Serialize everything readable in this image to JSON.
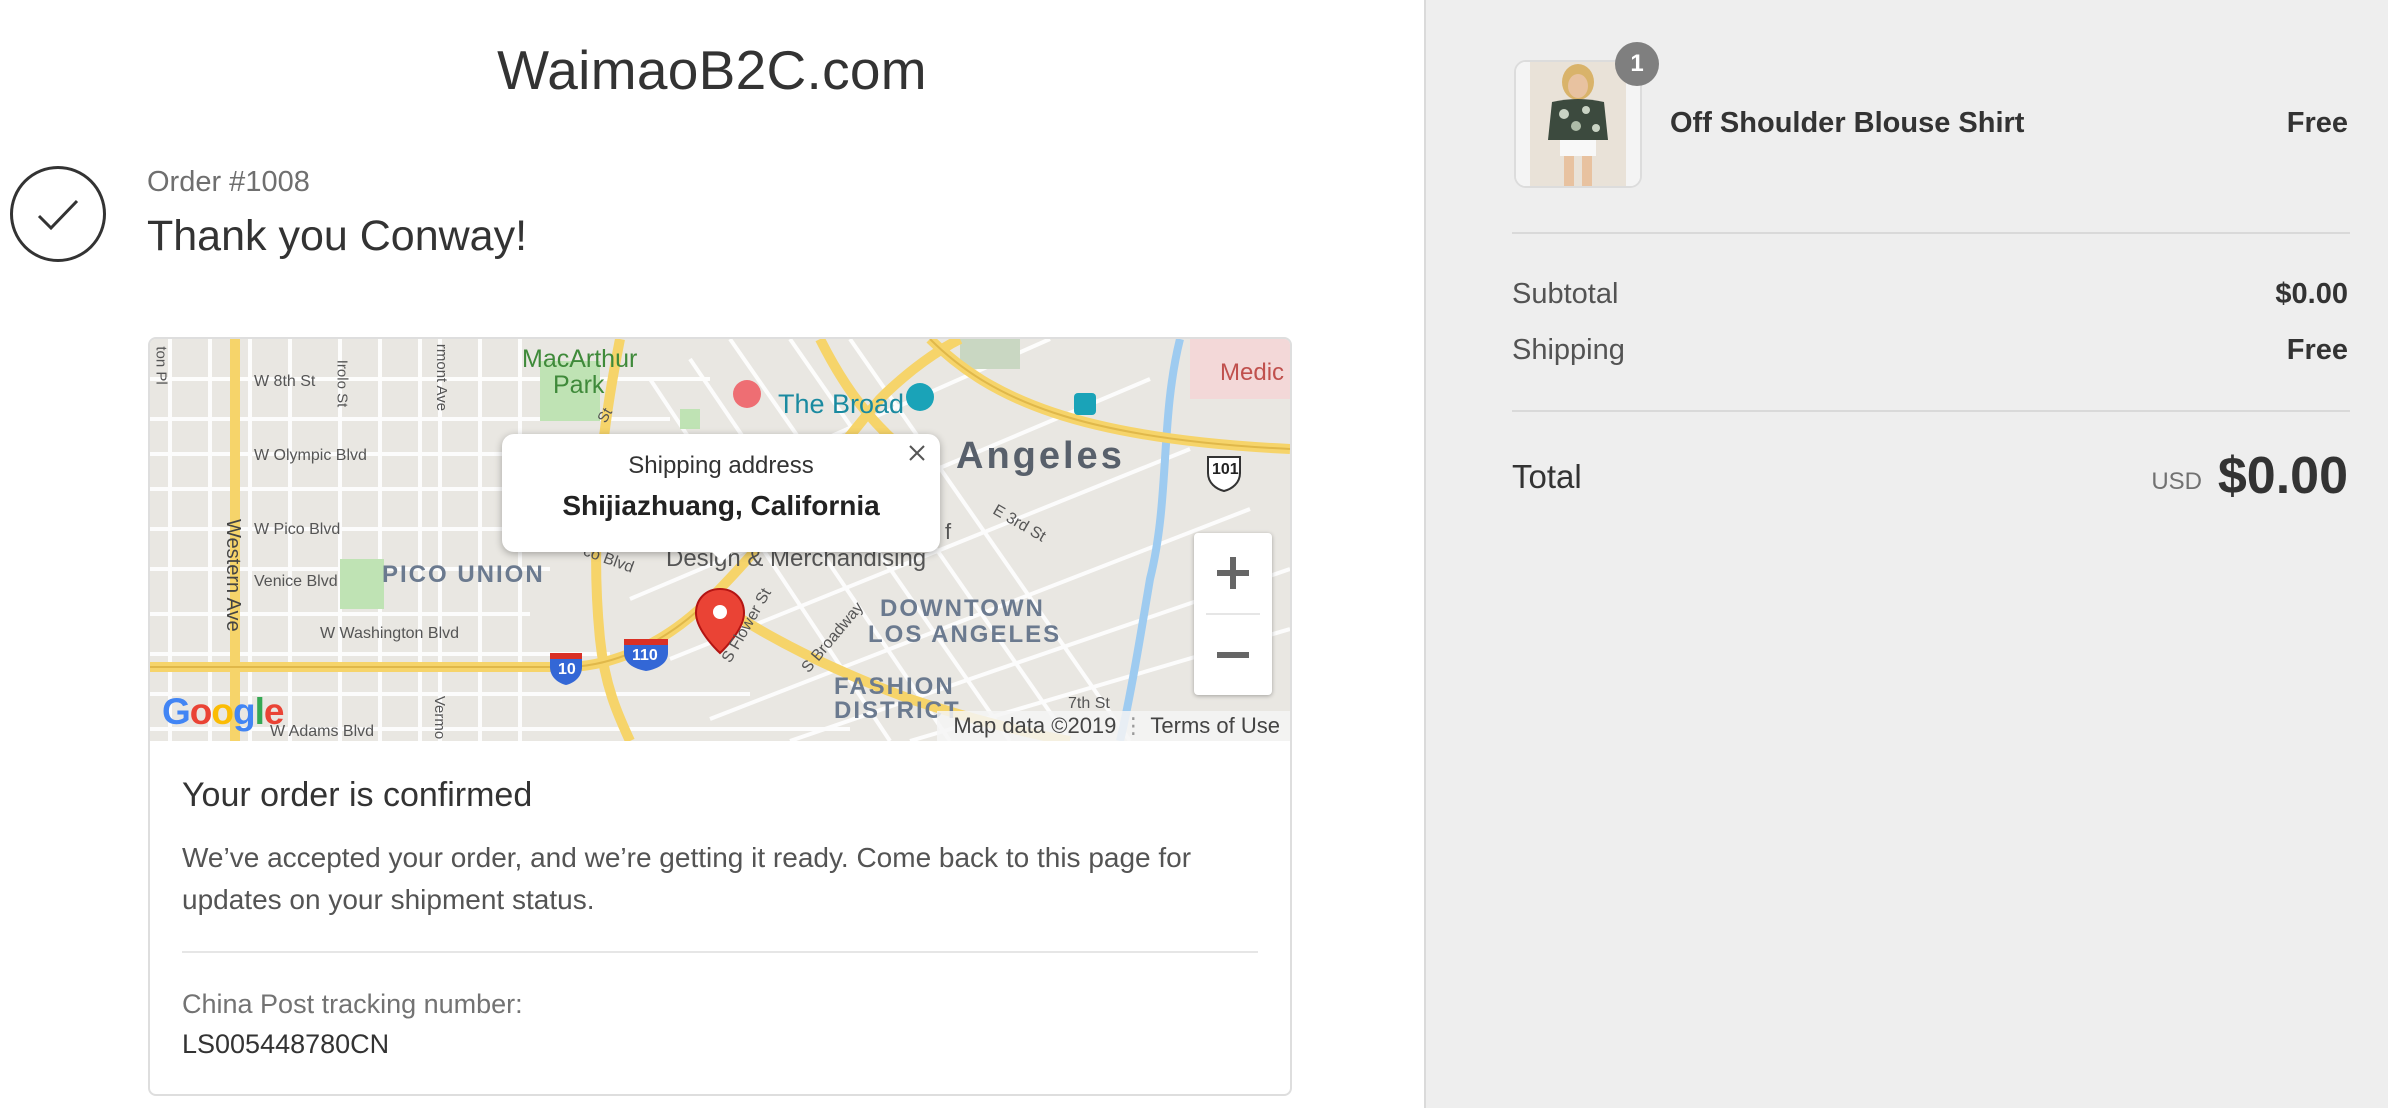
{
  "store": {
    "title": "WaimaoB2C.com"
  },
  "order": {
    "number": "Order #1008",
    "thank_you": "Thank you Conway!"
  },
  "map": {
    "popup": {
      "title": "Shipping address",
      "value": "Shijiazhuang, California"
    },
    "labels": {
      "macarthur": "MacArthur",
      "park": "Park",
      "the_broad": "The Broad",
      "angeles": "Angeles",
      "medic": "Medic",
      "w8th": "W 8th St",
      "olympic": "W Olympic Blvd",
      "pico_blvd": "W Pico Blvd",
      "venice": "Venice Blvd",
      "washington": "W Washington Blvd",
      "adams": "W Adams Blvd",
      "western": "Western Ave",
      "pico_union": "PICO UNION",
      "design": "Design & Merchandising",
      "downtown": "DOWNTOWN",
      "los_angeles": "LOS ANGELES",
      "fashion": "FASHION",
      "district": "DISTRICT",
      "e3rd": "E 3rd St",
      "s_broadway": "S Broadway",
      "s_flower": "S Flower St",
      "seventh": "7th St",
      "hwy_101": "101",
      "hwy_10": "10",
      "hwy_110": "110",
      "irolo": "Irolo St",
      "mont": "rmont Ave",
      "ton": "ton Pl",
      "vermo": "Vermo",
      "co_blvd": "co Blvd",
      "e_letter": "E",
      "f_letter": "f",
      "st_partial": "St"
    },
    "google_letters": [
      "G",
      "o",
      "o",
      "g",
      "l",
      "e"
    ],
    "footer": {
      "data": "Map data ©2019",
      "terms": "Terms of Use"
    },
    "zoom_in_icon": "plus-icon",
    "zoom_out_icon": "minus-icon"
  },
  "confirmation": {
    "title": "Your order is confirmed",
    "text": "We’ve accepted your order, and we’re getting it ready. Come back to this page for updates on your shipment status.",
    "tracking_label": "China Post tracking number:",
    "tracking_number": "LS005448780CN"
  },
  "summary": {
    "product": {
      "name": "Off Shoulder Blouse Shirt",
      "price": "Free",
      "quantity": "1"
    },
    "subtotal_label": "Subtotal",
    "subtotal_value": "$0.00",
    "shipping_label": "Shipping",
    "shipping_value": "Free",
    "total_label": "Total",
    "total_currency": "USD",
    "total_value": "$0.00"
  },
  "colors": {
    "sidebar_bg": "#eeeeee",
    "map_road": "#f6d46a",
    "map_park": "#bfe3b4",
    "map_water": "#9ecbf0",
    "pin": "#ea4335",
    "google_blue": "#4285f4",
    "google_red": "#ea4335",
    "google_yellow": "#fbbc05",
    "google_green": "#34a853"
  }
}
